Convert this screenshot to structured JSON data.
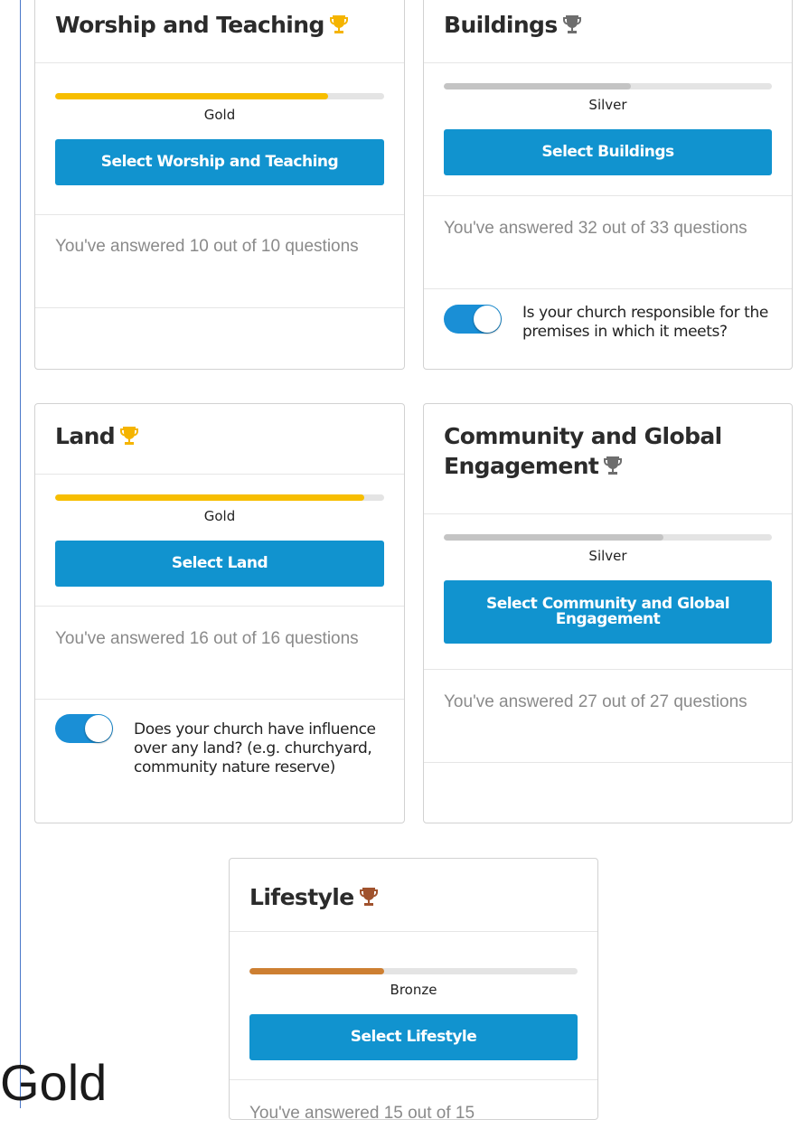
{
  "colors": {
    "gold": "#f7be00",
    "silver": "#c4c4c4",
    "bronze": "#cd7f32",
    "gold_trophy": "#f5b400",
    "silver_trophy": "#6e6e6e",
    "bronze_trophy": "#a0522d",
    "button": "#1193cf",
    "toggle": "#1a8fd6"
  },
  "cards": {
    "worship": {
      "title": "Worship and Teaching",
      "trophy_icon": "trophy-gold-icon",
      "level": "Gold",
      "progress": 0.83,
      "button": "Select Worship and Teaching",
      "answered": "You've answered 10 out of 10 questions"
    },
    "buildings": {
      "title": "Buildings",
      "trophy_icon": "trophy-silver-icon",
      "level": "Silver",
      "progress": 0.57,
      "button": "Select Buildings",
      "answered": "You've answered 32 out of 33 questions",
      "toggle_on": true,
      "toggle_label": "Is your church responsible for the premises in which it meets?"
    },
    "land": {
      "title": "Land",
      "trophy_icon": "trophy-gold-icon",
      "level": "Gold",
      "progress": 0.94,
      "button": "Select Land",
      "answered": "You've answered 16 out of 16 questions",
      "toggle_on": true,
      "toggle_label": "Does your church have influence over any land? (e.g. churchyard, community nature reserve)"
    },
    "community": {
      "title": "Community and Global Engagement",
      "trophy_icon": "trophy-silver-icon",
      "level": "Silver",
      "progress": 0.67,
      "button": "Select Community and Global Engagement",
      "answered": "You've answered 27 out of 27 questions"
    },
    "lifestyle": {
      "title": "Lifestyle",
      "trophy_icon": "trophy-bronze-icon",
      "level": "Bronze",
      "progress": 0.41,
      "button": "Select Lifestyle",
      "answered": "You've answered 15 out of 15"
    }
  },
  "overlay_text": "Gold"
}
